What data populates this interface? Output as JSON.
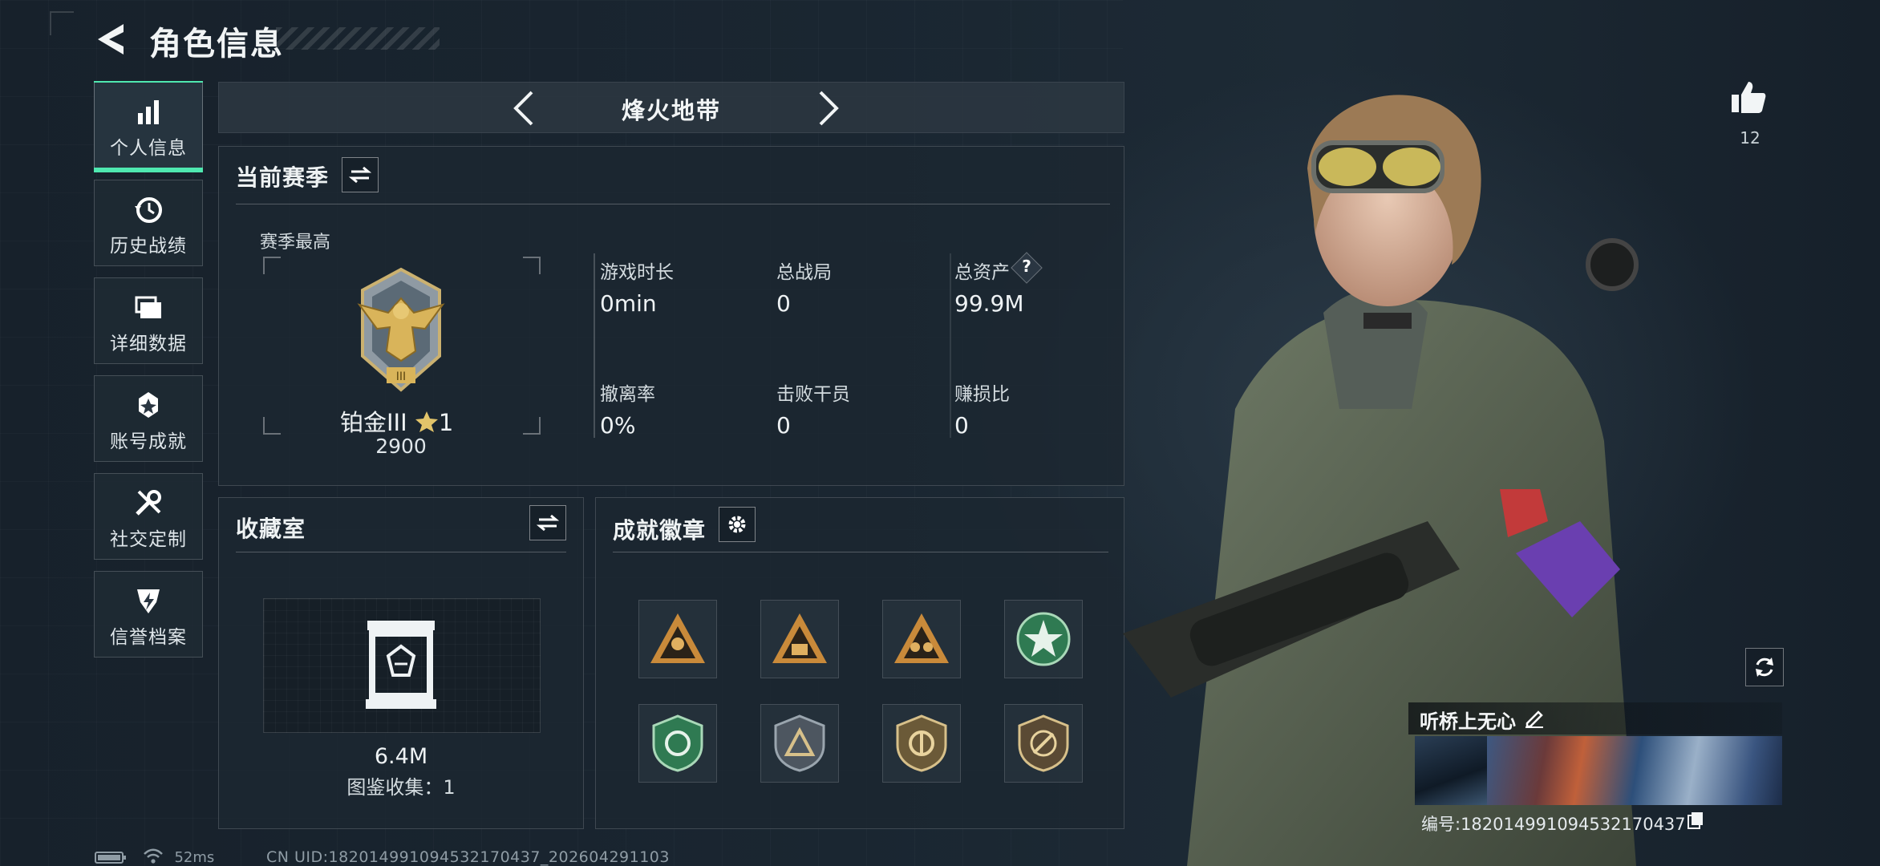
{
  "header": {
    "title": "角色信息"
  },
  "sidebar": {
    "items": [
      {
        "label": "个人信息",
        "icon": "bar-chart-icon",
        "active": true
      },
      {
        "label": "历史战绩",
        "icon": "history-icon",
        "active": false
      },
      {
        "label": "详细数据",
        "icon": "folder-icon",
        "active": false
      },
      {
        "label": "账号成就",
        "icon": "achievement-icon",
        "active": false
      },
      {
        "label": "社交定制",
        "icon": "tools-icon",
        "active": false
      },
      {
        "label": "信誉档案",
        "icon": "credit-icon",
        "active": false
      }
    ]
  },
  "mode": {
    "name": "烽火地带"
  },
  "season": {
    "title": "当前赛季",
    "best_label": "赛季最高",
    "rank": "铂金III",
    "stars": "1",
    "points": "2900",
    "stats": [
      {
        "label": "游戏时长",
        "value": "0min"
      },
      {
        "label": "总战局",
        "value": "0"
      },
      {
        "label": "总资产",
        "value": "99.9M",
        "help": "?"
      },
      {
        "label": "撤离率",
        "value": "0%"
      },
      {
        "label": "击败干员",
        "value": "0"
      },
      {
        "label": "赚损比",
        "value": "0"
      }
    ]
  },
  "collection": {
    "title": "收藏室",
    "value": "6.4M",
    "count_text": "图鉴收集：1"
  },
  "achievements": {
    "title": "成就徽章",
    "badges": [
      "badge-1",
      "badge-2",
      "badge-3",
      "badge-4",
      "badge-5",
      "badge-6",
      "badge-7",
      "badge-8"
    ]
  },
  "profile": {
    "likes": "12",
    "name": "听桥上无心",
    "id_text": "编号:182014991094532170437"
  },
  "status": {
    "ping": "52ms",
    "uid": "CN UID:182014991094532170437_202604291103"
  },
  "colors": {
    "accent": "#4fe8b0",
    "background": "#17222d",
    "gold": "#d9b45a"
  }
}
